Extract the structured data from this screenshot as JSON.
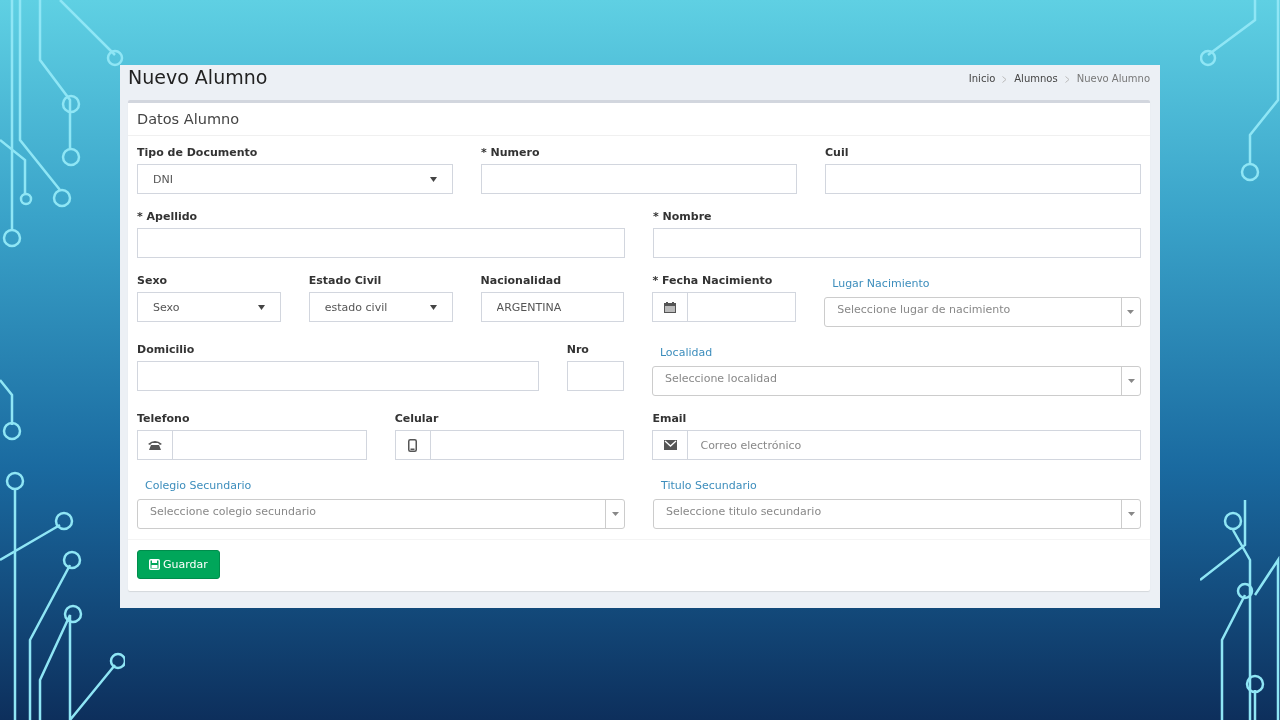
{
  "page": {
    "title": "Nuevo Alumno",
    "breadcrumb": [
      {
        "label": "Inicio",
        "current": false
      },
      {
        "label": "Alumnos",
        "current": false
      },
      {
        "label": "Nuevo Alumno",
        "current": true
      }
    ]
  },
  "box": {
    "title": "Datos Alumno",
    "fields": [
      {
        "kind": "select",
        "label": "Tipo de Documento",
        "value": "DNI"
      },
      {
        "kind": "text",
        "label": "* Numero"
      },
      {
        "kind": "text",
        "label": "Cuil"
      },
      {
        "kind": "text",
        "label": "* Apellido"
      },
      {
        "kind": "text",
        "label": "* Nombre"
      },
      {
        "kind": "select",
        "label": "Sexo",
        "value": "Sexo"
      },
      {
        "kind": "select",
        "label": "Estado Civil",
        "value": "estado civil"
      },
      {
        "kind": "text",
        "label": "Nacionalidad",
        "value": "ARGENTINA"
      },
      {
        "kind": "date",
        "label": "* Fecha Nacimiento"
      },
      {
        "kind": "combo",
        "label": "Lugar Nacimiento",
        "placeholder": "Seleccione lugar de nacimiento"
      },
      {
        "kind": "text",
        "label": "Domicilio"
      },
      {
        "kind": "text",
        "label": "Nro"
      },
      {
        "kind": "combo",
        "label": "Localidad",
        "placeholder": "Seleccione localidad"
      },
      {
        "kind": "phone",
        "label": "Telefono"
      },
      {
        "kind": "mobile",
        "label": "Celular"
      },
      {
        "kind": "email",
        "label": "Email",
        "placeholder": "Correo electrónico"
      },
      {
        "kind": "combo",
        "label": "Colegio Secundario",
        "placeholder": "Seleccione colegio secundario"
      },
      {
        "kind": "combo",
        "label": "Titulo Secundario",
        "placeholder": "Seleccione titulo secundario"
      }
    ],
    "button": {
      "label": "Guardar"
    }
  }
}
